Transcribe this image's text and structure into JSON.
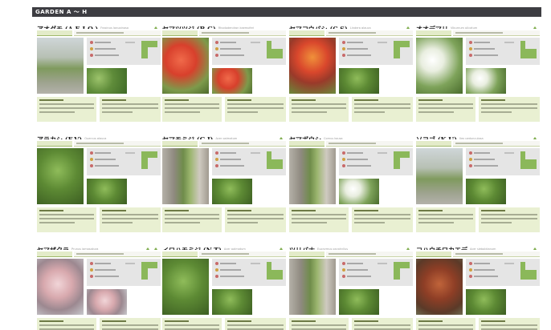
{
  "header": {
    "title": "GARDEN A ～ H"
  },
  "colors": {
    "header_bg": "#3d3d42",
    "accent_green": "#8bb85a",
    "desc_bg": "#e9f0d2",
    "panel_bg": "#e5e5e5"
  },
  "plants": [
    {
      "name": "アオダモ (A,E,I,Q,)",
      "latin": "Fraxinus lanuginosa",
      "leaves": 1,
      "photo": "tree",
      "small": "leaves"
    },
    {
      "name": "ヤマツツジ (B,G)",
      "latin": "Rhododendron kaempferi",
      "leaves": 0,
      "photo": "red-flowers",
      "small": "red-flowers"
    },
    {
      "name": "ヤマコウバシ (C,S)",
      "latin": "Lindera glauca",
      "leaves": 1,
      "photo": "autumn",
      "small": "green"
    },
    {
      "name": "オオデマリ",
      "latin": "Viburnum plicatum",
      "leaves": 1,
      "photo": "white-flowers",
      "small": "white-flowers"
    },
    {
      "name": "アラカシ (F,V)",
      "latin": "Quercus glauca",
      "leaves": 0,
      "photo": "green",
      "small": "green"
    },
    {
      "name": "ヤマモミジ (G,J)",
      "latin": "Acer palmatum",
      "leaves": 1,
      "photo": "building",
      "small": "green"
    },
    {
      "name": "ヤマボウシ",
      "latin": "Cornus kousa",
      "leaves": 0,
      "photo": "building",
      "small": "white-flowers"
    },
    {
      "name": "ソヨゴ (K,U)",
      "latin": "Ilex pedunculosa",
      "leaves": 1,
      "photo": "tree",
      "small": "green"
    },
    {
      "name": "ヤマザクラ",
      "latin": "Prunus jamasakura",
      "leaves": 2,
      "photo": "blossom",
      "small": "blossom"
    },
    {
      "name": "イロハモミジ (N,T)",
      "latin": "Acer palmatum",
      "leaves": 1,
      "photo": "green",
      "small": "green"
    },
    {
      "name": "ツリバナ",
      "latin": "Euonymus oxyphyllus",
      "leaves": 1,
      "photo": "building",
      "small": "green"
    },
    {
      "name": "コハウチワカエデ",
      "latin": "Acer sieboldianum",
      "leaves": 1,
      "photo": "autumn-dark",
      "small": "green"
    }
  ]
}
